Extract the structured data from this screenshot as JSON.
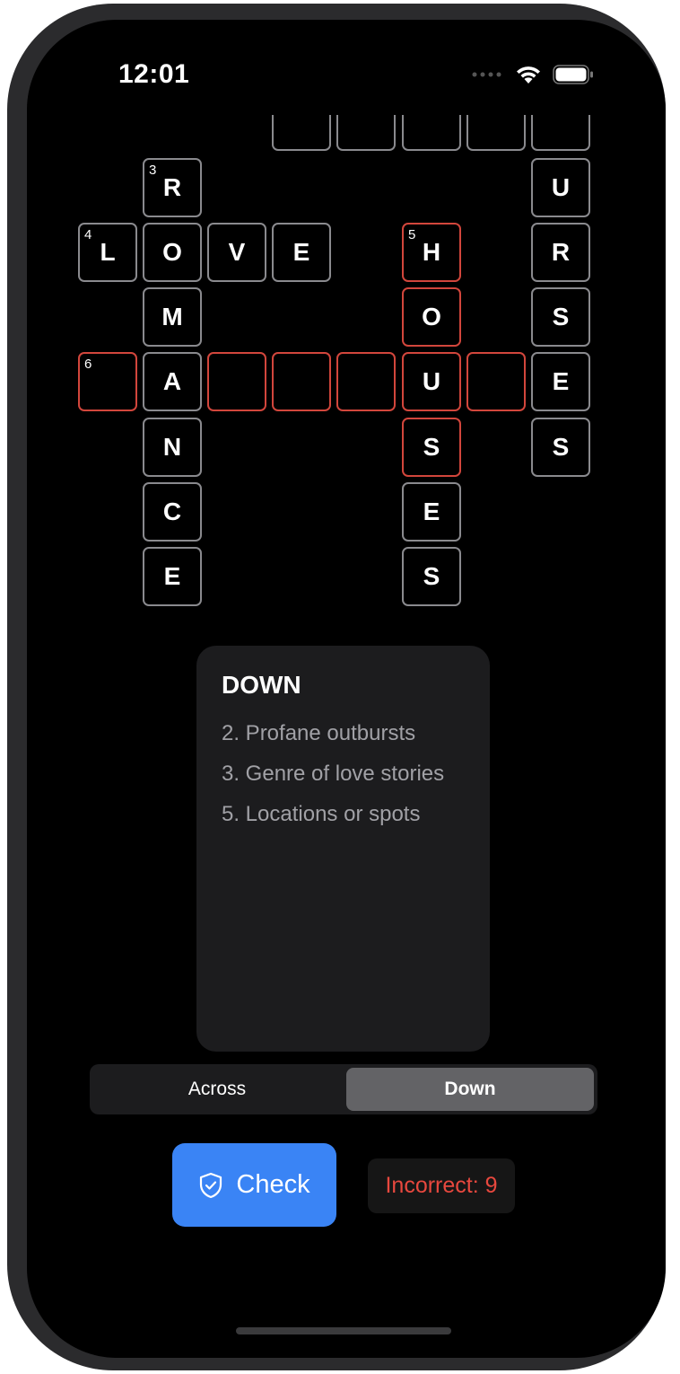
{
  "status_bar": {
    "time": "12:01",
    "icons": [
      "cellular-icon",
      "wifi-icon",
      "battery-icon"
    ]
  },
  "crossword": {
    "cells": [
      {
        "id": "c-r0-3",
        "letter": "",
        "number": "",
        "highlight": false
      },
      {
        "id": "c-r0-4",
        "letter": "",
        "number": "",
        "highlight": false
      },
      {
        "id": "c-r0-5",
        "letter": "",
        "number": "",
        "highlight": false
      },
      {
        "id": "c-r0-6",
        "letter": "",
        "number": "",
        "highlight": false
      },
      {
        "id": "c-r0-7",
        "letter": "",
        "number": "",
        "highlight": false
      },
      {
        "id": "c-r1-1",
        "letter": "R",
        "number": "3",
        "highlight": false
      },
      {
        "id": "c-r1-7",
        "letter": "U",
        "number": "",
        "highlight": false
      },
      {
        "id": "c-r2-0",
        "letter": "L",
        "number": "4",
        "highlight": false
      },
      {
        "id": "c-r2-1",
        "letter": "O",
        "number": "",
        "highlight": false
      },
      {
        "id": "c-r2-2",
        "letter": "V",
        "number": "",
        "highlight": false
      },
      {
        "id": "c-r2-3",
        "letter": "E",
        "number": "",
        "highlight": false
      },
      {
        "id": "c-r2-5",
        "letter": "H",
        "number": "5",
        "highlight": true
      },
      {
        "id": "c-r2-7",
        "letter": "R",
        "number": "",
        "highlight": false
      },
      {
        "id": "c-r3-1",
        "letter": "M",
        "number": "",
        "highlight": false
      },
      {
        "id": "c-r3-5",
        "letter": "O",
        "number": "",
        "highlight": true
      },
      {
        "id": "c-r3-7",
        "letter": "S",
        "number": "",
        "highlight": false
      },
      {
        "id": "c-r4-0",
        "letter": "",
        "number": "6",
        "highlight": true
      },
      {
        "id": "c-r4-1",
        "letter": "A",
        "number": "",
        "highlight": false
      },
      {
        "id": "c-r4-2",
        "letter": "",
        "number": "",
        "highlight": true
      },
      {
        "id": "c-r4-3",
        "letter": "",
        "number": "",
        "highlight": true
      },
      {
        "id": "c-r4-4",
        "letter": "",
        "number": "",
        "highlight": true
      },
      {
        "id": "c-r4-5",
        "letter": "U",
        "number": "",
        "highlight": true
      },
      {
        "id": "c-r4-6",
        "letter": "",
        "number": "",
        "highlight": true
      },
      {
        "id": "c-r4-7",
        "letter": "E",
        "number": "",
        "highlight": false
      },
      {
        "id": "c-r5-1",
        "letter": "N",
        "number": "",
        "highlight": false
      },
      {
        "id": "c-r5-5",
        "letter": "S",
        "number": "",
        "highlight": true
      },
      {
        "id": "c-r5-7",
        "letter": "S",
        "number": "",
        "highlight": false
      },
      {
        "id": "c-r6-1",
        "letter": "C",
        "number": "",
        "highlight": false
      },
      {
        "id": "c-r6-5",
        "letter": "E",
        "number": "",
        "highlight": false
      },
      {
        "id": "c-r7-1",
        "letter": "E",
        "number": "",
        "highlight": false
      },
      {
        "id": "c-r7-5",
        "letter": "S",
        "number": "",
        "highlight": false
      }
    ]
  },
  "clues": {
    "title": "DOWN",
    "items": [
      "2. Profane outbursts",
      "3. Genre of love stories",
      "5. Locations or spots"
    ]
  },
  "segmented": {
    "across_label": "Across",
    "down_label": "Down",
    "selected": "Down"
  },
  "check_button": {
    "label": "Check",
    "icon": "shield-check-icon"
  },
  "incorrect": {
    "label": "Incorrect: 9"
  },
  "colors": {
    "accent": "#3a84f5",
    "error": "#e8483e",
    "highlight_border": "#d2463c"
  }
}
